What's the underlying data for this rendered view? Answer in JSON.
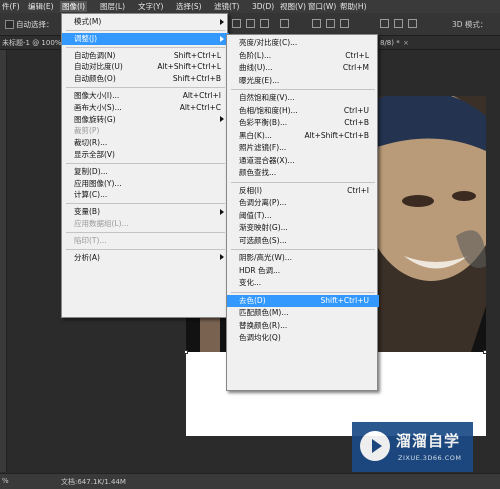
{
  "menubar": {
    "items": [
      {
        "label": "件(F)"
      },
      {
        "label": "编辑(E)"
      },
      {
        "label": "图像(I)"
      },
      {
        "label": "图层(L)"
      },
      {
        "label": "文字(Y)"
      },
      {
        "label": "选择(S)"
      },
      {
        "label": "滤镜(T)"
      },
      {
        "label": "3D(D)"
      },
      {
        "label": "视图(V)"
      },
      {
        "label": "窗口(W)"
      },
      {
        "label": "帮助(H)"
      }
    ],
    "active_index": 2
  },
  "options_bar": {
    "auto_select_label": "自动选择：",
    "mode_3d_label": "3D 模式："
  },
  "tabs": {
    "left_tab": "未标题-1 @ 100%",
    "right_tab": "8/8) *",
    "close_glyph": "×"
  },
  "status_bar": {
    "zoom": "%",
    "doc_info": "文档:647.1K/1.44M"
  },
  "image_menu": {
    "items": [
      {
        "label": "模式(M)",
        "shortcut": "",
        "submenu": true,
        "disabled": false
      },
      {
        "sep": true
      },
      {
        "label": "调整(J)",
        "shortcut": "",
        "submenu": true,
        "disabled": false,
        "highlight": true
      },
      {
        "sep": true
      },
      {
        "label": "自动色调(N)",
        "shortcut": "Shift+Ctrl+L",
        "submenu": false,
        "disabled": false
      },
      {
        "label": "自动对比度(U)",
        "shortcut": "Alt+Shift+Ctrl+L",
        "submenu": false,
        "disabled": false
      },
      {
        "label": "自动颜色(O)",
        "shortcut": "Shift+Ctrl+B",
        "submenu": false,
        "disabled": false
      },
      {
        "sep": true
      },
      {
        "label": "图像大小(I)...",
        "shortcut": "Alt+Ctrl+I",
        "submenu": false,
        "disabled": false
      },
      {
        "label": "画布大小(S)...",
        "shortcut": "Alt+Ctrl+C",
        "submenu": false,
        "disabled": false
      },
      {
        "label": "图像旋转(G)",
        "shortcut": "",
        "submenu": true,
        "disabled": false
      },
      {
        "label": "裁剪(P)",
        "shortcut": "",
        "submenu": false,
        "disabled": true
      },
      {
        "label": "裁切(R)...",
        "shortcut": "",
        "submenu": false,
        "disabled": false
      },
      {
        "label": "显示全部(V)",
        "shortcut": "",
        "submenu": false,
        "disabled": false
      },
      {
        "sep": true
      },
      {
        "label": "复制(D)...",
        "shortcut": "",
        "submenu": false,
        "disabled": false
      },
      {
        "label": "应用图像(Y)...",
        "shortcut": "",
        "submenu": false,
        "disabled": false
      },
      {
        "label": "计算(C)...",
        "shortcut": "",
        "submenu": false,
        "disabled": false
      },
      {
        "sep": true
      },
      {
        "label": "变量(B)",
        "shortcut": "",
        "submenu": true,
        "disabled": false
      },
      {
        "label": "应用数据组(L)...",
        "shortcut": "",
        "submenu": false,
        "disabled": true
      },
      {
        "sep": true
      },
      {
        "label": "陷印(T)...",
        "shortcut": "",
        "submenu": false,
        "disabled": true
      },
      {
        "sep": true
      },
      {
        "label": "分析(A)",
        "shortcut": "",
        "submenu": true,
        "disabled": false
      }
    ]
  },
  "adjust_menu": {
    "items": [
      {
        "label": "亮度/对比度(C)...",
        "shortcut": ""
      },
      {
        "label": "色阶(L)...",
        "shortcut": "Ctrl+L"
      },
      {
        "label": "曲线(U)...",
        "shortcut": "Ctrl+M"
      },
      {
        "label": "曝光度(E)...",
        "shortcut": ""
      },
      {
        "sep": true
      },
      {
        "label": "自然饱和度(V)...",
        "shortcut": ""
      },
      {
        "label": "色相/饱和度(H)...",
        "shortcut": "Ctrl+U"
      },
      {
        "label": "色彩平衡(B)...",
        "shortcut": "Ctrl+B"
      },
      {
        "label": "黑白(K)...",
        "shortcut": "Alt+Shift+Ctrl+B"
      },
      {
        "label": "照片滤镜(F)...",
        "shortcut": ""
      },
      {
        "label": "通道混合器(X)...",
        "shortcut": ""
      },
      {
        "label": "颜色查找...",
        "shortcut": ""
      },
      {
        "sep": true
      },
      {
        "label": "反相(I)",
        "shortcut": "Ctrl+I"
      },
      {
        "label": "色调分离(P)...",
        "shortcut": ""
      },
      {
        "label": "阈值(T)...",
        "shortcut": ""
      },
      {
        "label": "渐变映射(G)...",
        "shortcut": ""
      },
      {
        "label": "可选颜色(S)...",
        "shortcut": ""
      },
      {
        "sep": true
      },
      {
        "label": "阴影/高光(W)...",
        "shortcut": ""
      },
      {
        "label": "HDR 色调...",
        "shortcut": ""
      },
      {
        "label": "变化...",
        "shortcut": ""
      },
      {
        "sep": true
      },
      {
        "label": "去色(D)",
        "shortcut": "Shift+Ctrl+U",
        "highlight": true
      },
      {
        "label": "匹配颜色(M)...",
        "shortcut": ""
      },
      {
        "label": "替换颜色(R)...",
        "shortcut": ""
      },
      {
        "label": "色调均化(Q)",
        "shortcut": ""
      }
    ]
  },
  "watermark": {
    "name": "溜溜自学",
    "url": "ZIXUE.3D66.COM"
  },
  "colors": {
    "highlight": "#3399ff",
    "menu_bg": "#f0f0f0",
    "ui_dark": "#3a3a3a"
  }
}
